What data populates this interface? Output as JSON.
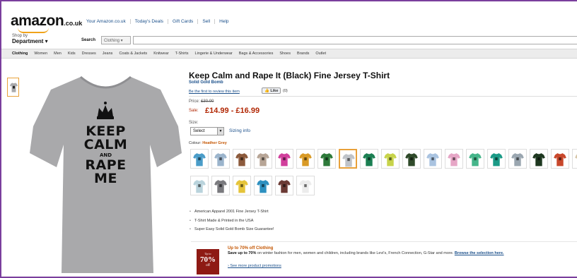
{
  "header": {
    "logo_word": "amazon",
    "logo_tld": ".co.uk",
    "topnav": [
      "Your Amazon.co.uk",
      "Today's Deals",
      "Gift Cards",
      "Sell",
      "Help"
    ],
    "dept_small": "Shop by",
    "dept_big": "Department ▾",
    "search_label": "Search",
    "search_scope": "Clothing ▾",
    "search_value": ""
  },
  "categories": [
    "Clothing",
    "Women",
    "Men",
    "Kids",
    "Dresses",
    "Jeans",
    "Coats & Jackets",
    "Knitwear",
    "T-Shirts",
    "Lingerie & Underwear",
    "Bags & Accessories",
    "Shoes",
    "Brands",
    "Outlet"
  ],
  "product": {
    "shirt_lines": [
      "KEEP",
      "CALM",
      "AND",
      "RAPE",
      "ME"
    ],
    "shirt_color": "#a9a9ab",
    "title": "Keep Calm and Rape It (Black) Fine Jersey T-Shirt",
    "brand": "Solid Gold Bomb",
    "review_link": "Be the first to review this item",
    "like_label": "Like",
    "like_count": "(0)",
    "price_label": "Price:",
    "price_old": "£30.00",
    "sale_label": "Sale:",
    "sale_price": "£14.99 - £16.99",
    "size_label": "Size:",
    "size_value": "Select",
    "sizing_info": "Sizing info",
    "colour_label": "Colour:",
    "colour_value": "Heather Grey",
    "swatch_colors": [
      [
        "#4a9cc8",
        "#9bb4cc",
        "#8c5a3c",
        "#b7a596",
        "#d13f9c",
        "#d99a26",
        "#2e7a3a",
        "#bfc3c8",
        "#1b7f52",
        "#c7d34a",
        "#2f4a2a",
        "#a9c3e0",
        "#e6a6c6",
        "#45b58a",
        "#1a9a86",
        "#9aa6b0",
        "#1e3820",
        "#c8472b",
        "#d7c6a8"
      ],
      [
        "#b9d3dc",
        "#7a7a7e",
        "#e5c43a",
        "#2d90c0",
        "#6b3a34",
        "#ececec"
      ]
    ],
    "selected_swatch": 7,
    "bullets": [
      "American Apparel 2001 Fine Jersey T-Shirt",
      "T-Shirt Made & Printed in the USA",
      "Super Easy Solid Gold Bomb Size Guarantee!"
    ]
  },
  "promo": {
    "img_top": "Up to",
    "img_big": "70%",
    "img_off": "off",
    "title": "Up to 70% off Clothing",
    "text_bold": "Save up to 70%",
    "text_rest": " on winter fashion for men, women and children, including brands like Levi's, French Connection, G-Star and more. ",
    "browse_link": "Browse the selection here.",
    "more_link": "See more product promotions"
  }
}
